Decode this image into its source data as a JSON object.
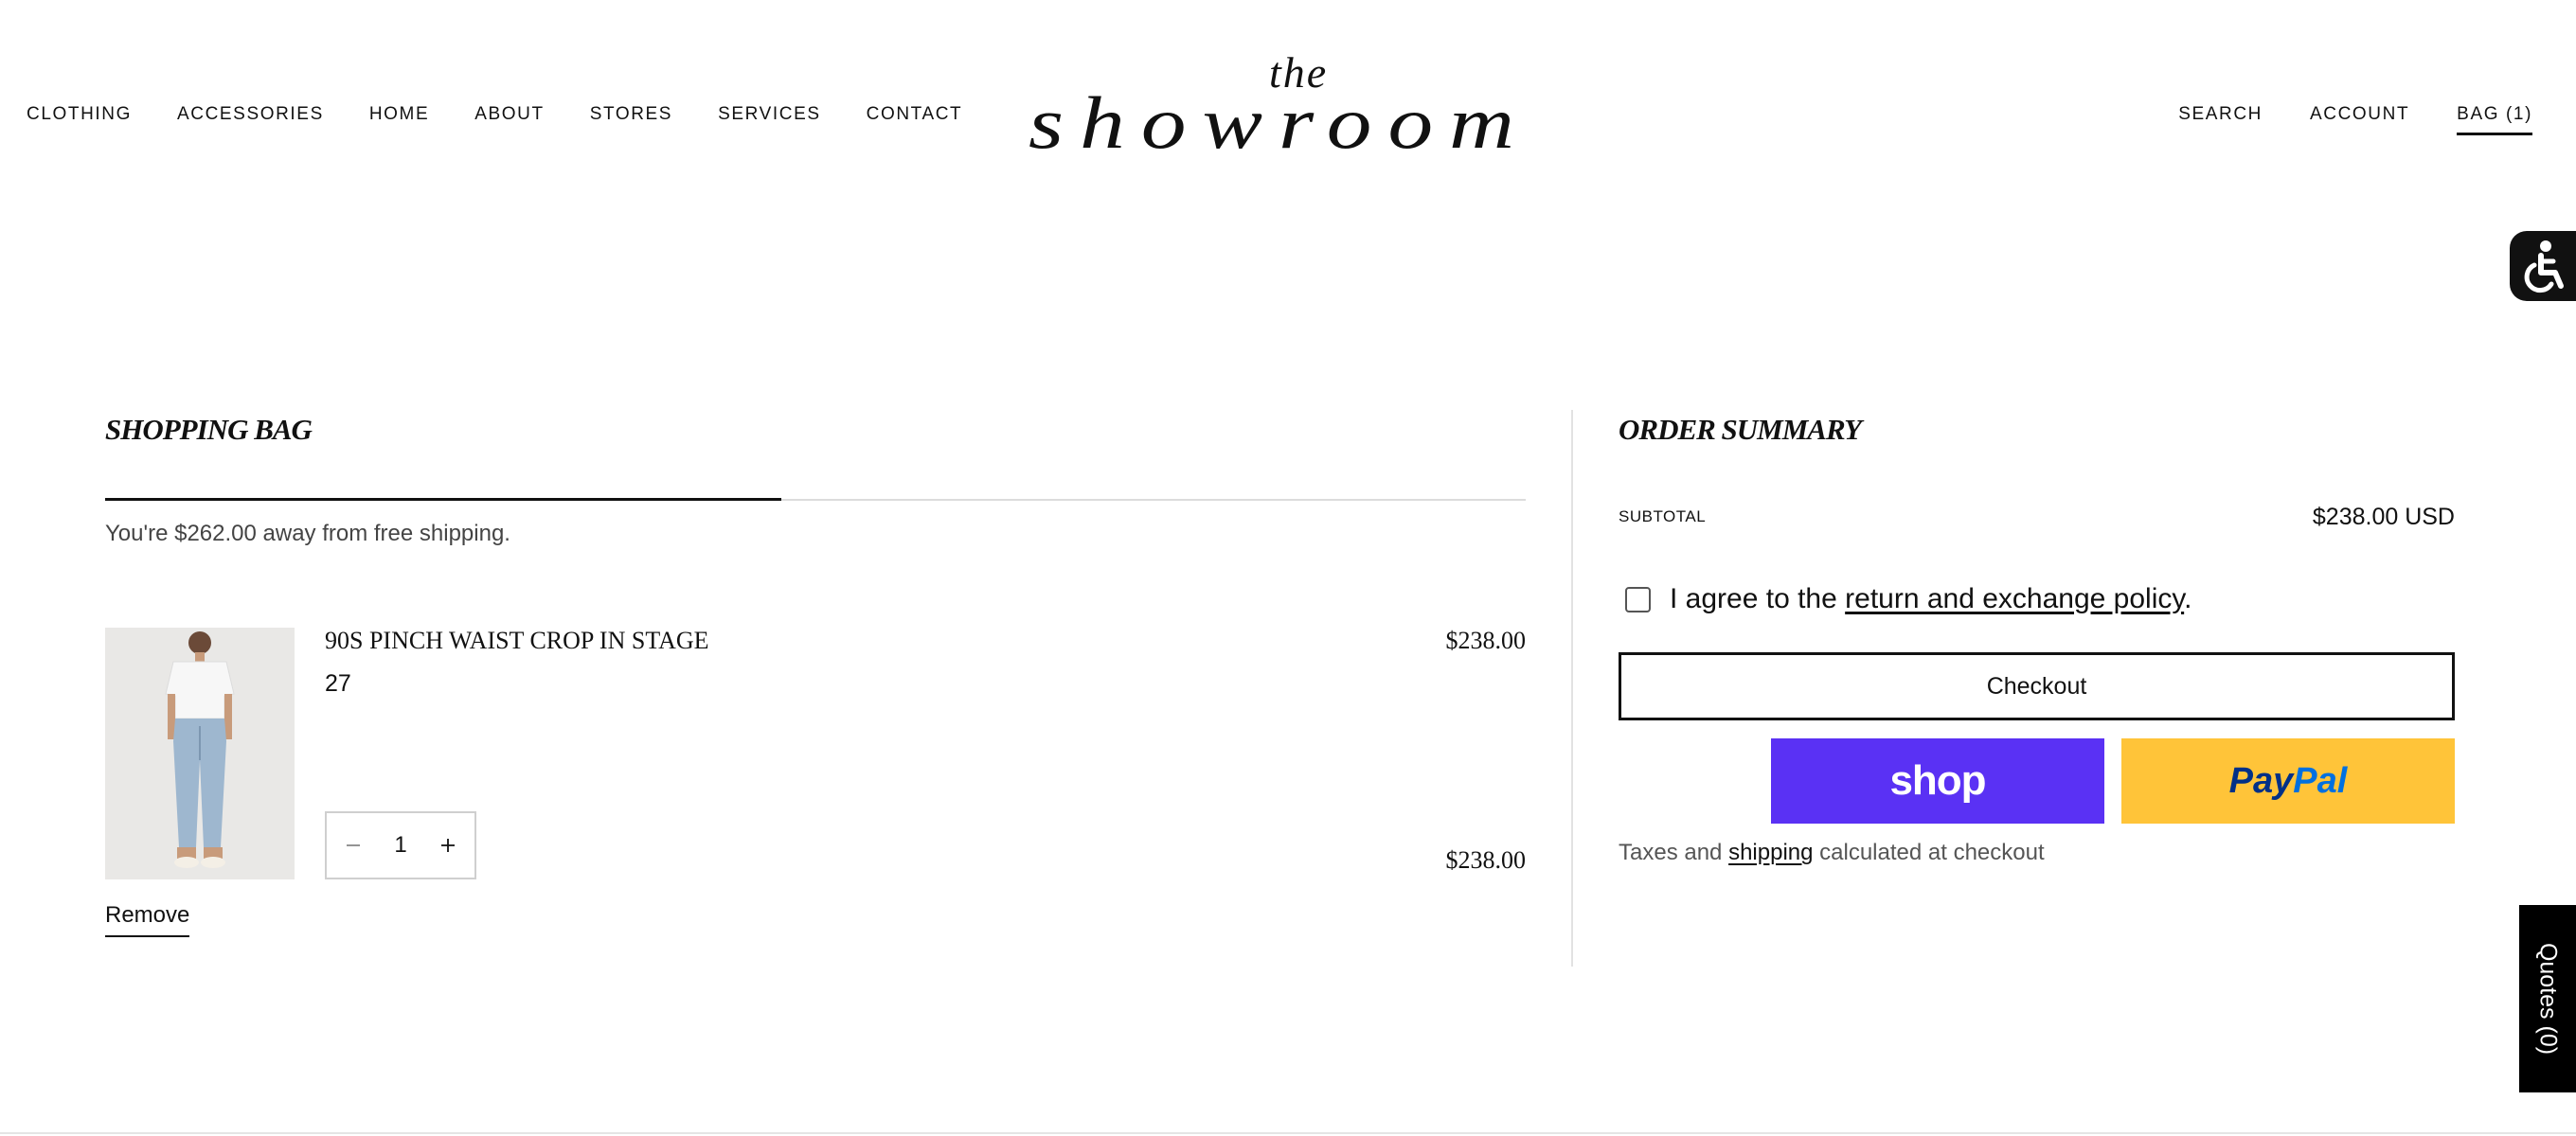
{
  "nav": {
    "left": [
      "CLOTHING",
      "ACCESSORIES",
      "HOME",
      "ABOUT",
      "STORES",
      "SERVICES",
      "CONTACT"
    ],
    "right": {
      "search": "SEARCH",
      "account": "ACCOUNT",
      "bag": "BAG (1)"
    }
  },
  "logo": {
    "line1": "the",
    "line2": "showroom"
  },
  "bag": {
    "title": "SHOPPING BAG",
    "shipping_message": "You're $262.00 away from free shipping.",
    "free_shipping_progress": 0.476,
    "remove_label": "Remove",
    "items": [
      {
        "name": "90S PINCH WAIST CROP IN STAGE",
        "size": "27",
        "price": "$238.00",
        "quantity": "1",
        "line_total": "$238.00"
      }
    ]
  },
  "summary": {
    "title": "ORDER SUMMARY",
    "subtotal_label": "SUBTOTAL",
    "subtotal_value": "$238.00 USD",
    "agree_prefix": "I agree to the ",
    "agree_link": "return and exchange policy",
    "agree_suffix": ".",
    "checkout_label": "Checkout",
    "shop_pay_label": "shop",
    "paypal_pay": "Pay",
    "paypal_pal": "Pal",
    "taxes_prefix": "Taxes and ",
    "taxes_link": "shipping",
    "taxes_suffix": " calculated at checkout"
  },
  "widgets": {
    "quotes_label": "Quotes (0)"
  },
  "colors": {
    "shop_pay": "#5a31f4",
    "paypal": "#ffc439",
    "paypal_dark": "#003087",
    "paypal_light": "#0070e0",
    "text": "#111111"
  },
  "icons": {
    "accessibility": "wheelchair-icon",
    "minus": "minus-icon",
    "plus": "plus-icon"
  }
}
